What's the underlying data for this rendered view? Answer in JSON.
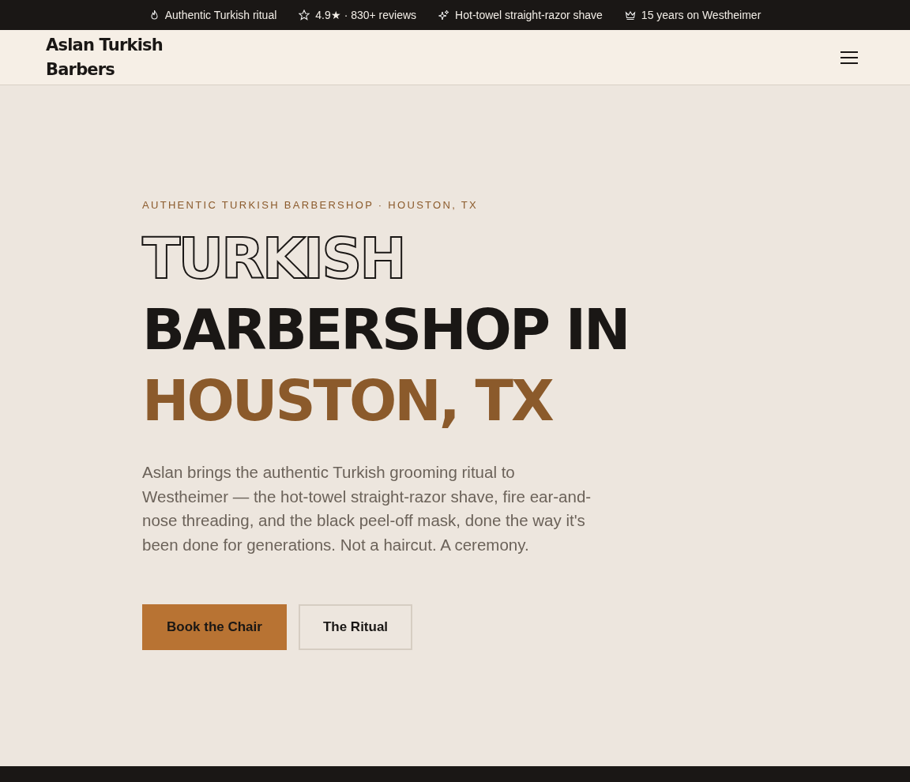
{
  "announcement_bar": [
    {
      "text": "Authentic Turkish ritual"
    },
    {
      "text": "4.9★ · 830+ reviews"
    },
    {
      "text": "Hot-towel straight-razor shave"
    },
    {
      "text": "15 years on Westheimer"
    }
  ],
  "header": {
    "logo": "Aslan Turkish Barbers"
  },
  "hero": {
    "eyebrow": "AUTHENTIC TURKISH BARBERSHOP · HOUSTON, TX",
    "headline": [
      {
        "kind": "outline",
        "text": "TURKISH"
      },
      {
        "kind": "solid",
        "text": "BARBERSHOP IN"
      },
      {
        "kind": "accent",
        "text": "HOUSTON, TX"
      }
    ],
    "description": "Aslan brings the authentic Turkish grooming ritual to Westheimer — the hot-towel straight-razor shave, fire ear-and-nose threading, and the black peel-off mask, done the way it's been done for generations. Not a haircut. A ceremony.",
    "buttons": [
      {
        "kind": "primary",
        "label": "Book the Chair"
      },
      {
        "kind": "secondary",
        "label": "The Ritual"
      }
    ]
  }
}
